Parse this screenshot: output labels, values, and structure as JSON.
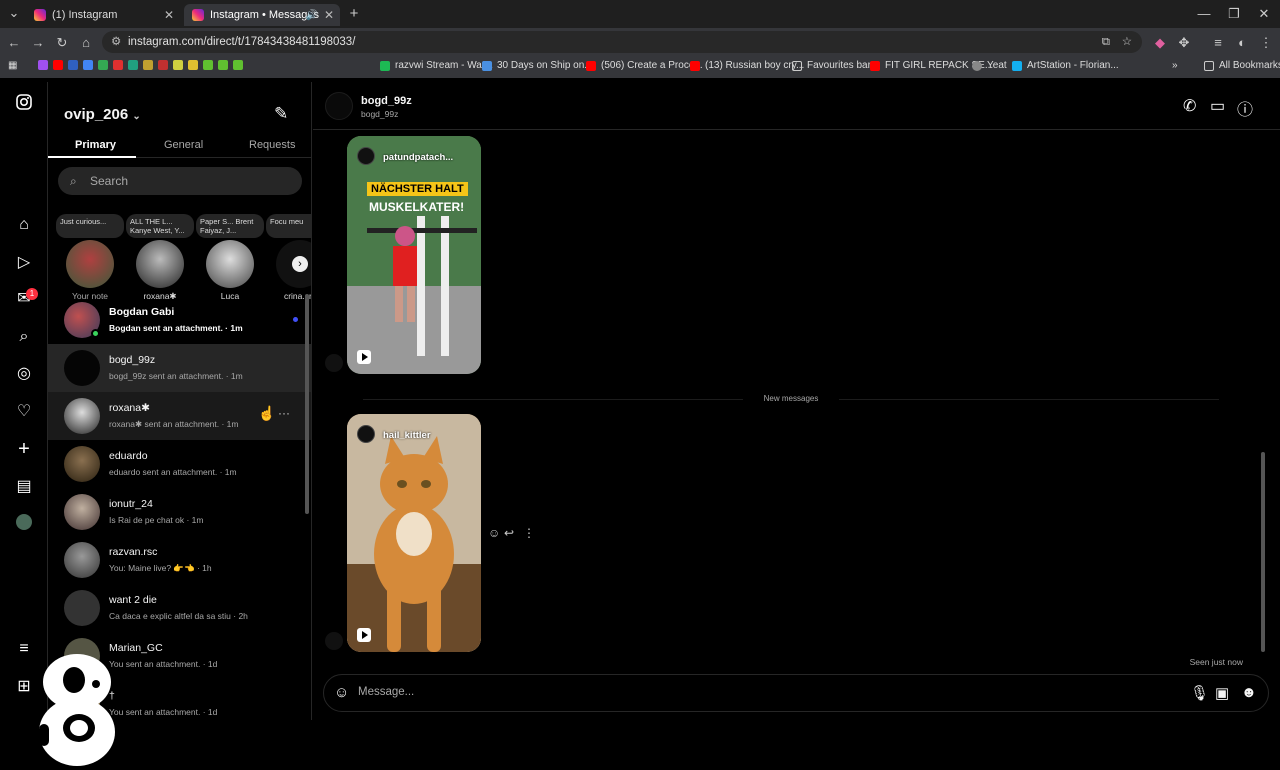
{
  "browser": {
    "tabs": [
      {
        "title": "(1) Instagram",
        "close": "✕"
      },
      {
        "title": "Instagram • Messages",
        "close": "✕"
      }
    ],
    "new_tab": "+",
    "window_controls": [
      "—",
      "❐",
      "✕"
    ],
    "url": "instagram.com/direct/t/17843438481198033/",
    "bookmarks": [
      {
        "label": "razvwi Stream - Wat...",
        "color": "#1db954"
      },
      {
        "label": "30 Days on Ship on...",
        "color": "#4a90e2"
      },
      {
        "label": "(506) Create a Proce...",
        "color": "#ff0000"
      },
      {
        "label": "(13) Russian boy cry...",
        "color": "#ff0000"
      },
      {
        "label": "Favourites bar",
        "color": "#cccccc"
      },
      {
        "label": "FIT GIRL REPACK SE...",
        "color": "#ff0000"
      },
      {
        "label": "Yeat",
        "color": "#888888"
      },
      {
        "label": "ArtStation - Florian...",
        "color": "#13aff0"
      }
    ],
    "bookmarks_overflow": "»",
    "all_bookmarks": "All Bookmarks"
  },
  "inbox": {
    "username": "ovip_206",
    "tabs": [
      "Primary",
      "General",
      "Requests"
    ],
    "search_placeholder": "Search",
    "notes": [
      {
        "bubble": "Just curious...",
        "name": "Your note"
      },
      {
        "bubble": "ALL THE L... Kanye West, Y...",
        "name": "roxana✱"
      },
      {
        "bubble": "Paper S... Brent Faiyaz, J...",
        "name": "Luca"
      },
      {
        "bubble": "Focu meu",
        "name": "crina.cm"
      }
    ],
    "threads": [
      {
        "name": "Bogdan Gabi",
        "preview": "Bogdan sent an attachment. · 1m",
        "unread": true,
        "online": true,
        "avatar": "#7a2a2a"
      },
      {
        "name": "bogd_99z",
        "preview": "bogd_99z sent an attachment. · 1m",
        "avatar": "#050505"
      },
      {
        "name": "roxana✱",
        "preview": "roxana✱ sent an attachment. · 1m",
        "avatar": "#444"
      },
      {
        "name": "eduardo",
        "preview": "eduardo sent an attachment. · 1m",
        "avatar": "#5a4a30"
      },
      {
        "name": "ionutr_24",
        "preview": "Is Rai de pe chat ok · 1m",
        "avatar": "#8a7a70"
      },
      {
        "name": "razvan.rsc",
        "preview": "You: Maine live? 👉👈 · 1h",
        "avatar": "#6a6a6a"
      },
      {
        "name": "want 2 die",
        "preview": "Ca daca e explic altfel da sa stiu · 2h",
        "avatar": "#333"
      },
      {
        "name": "Marian_GC",
        "preview": "You sent an attachment. · 1d",
        "avatar": "#554"
      },
      {
        "name": "†",
        "preview": "You sent an attachment. · 1d",
        "avatar": "#a08060"
      }
    ]
  },
  "chat": {
    "contact_name": "bogd_99z",
    "contact_handle": "bogd_99z",
    "reels": [
      {
        "user": "patundpatach...",
        "caption_line1": "NÄCHSTER HALT",
        "caption_line2": "MUSKELKATER!"
      },
      {
        "user": "hail_kittler"
      }
    ],
    "divider": "New messages",
    "seen": "Seen just now",
    "message_placeholder": "Message..."
  },
  "colors": {
    "background": "#000000",
    "panel_border": "#262626",
    "selected_row": "#262626",
    "unread_dot": "#4150f7",
    "online": "#3ad35c",
    "badge": "#ff3040"
  },
  "rail_badge": "1"
}
